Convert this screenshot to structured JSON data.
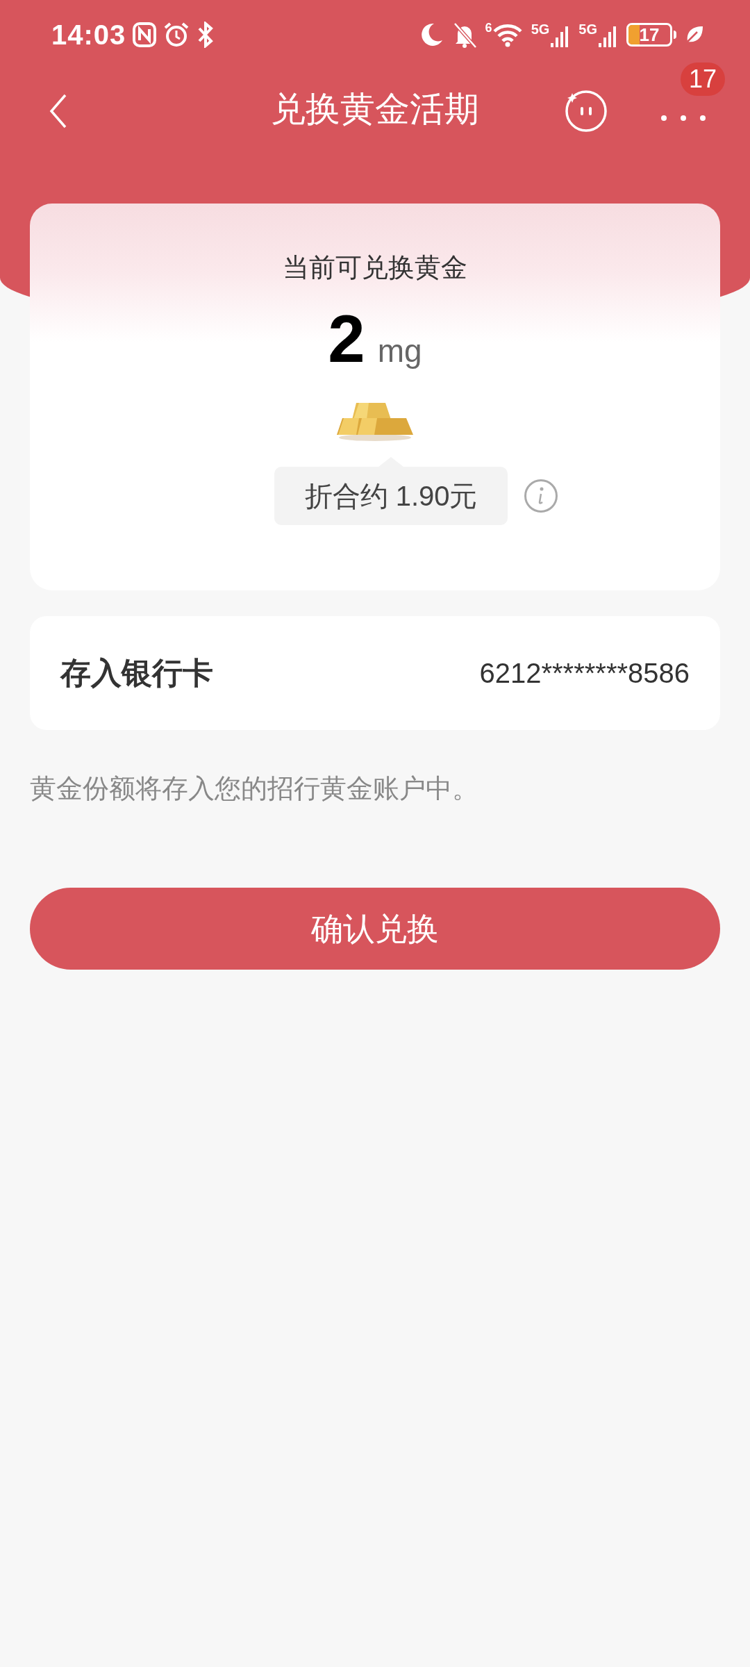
{
  "status_bar": {
    "time": "14:03",
    "wifi_label": "6",
    "signal_labels": [
      "5G",
      "5G"
    ],
    "battery": "17"
  },
  "header": {
    "title": "兑换黄金活期",
    "badge": "17"
  },
  "gold_card": {
    "label": "当前可兑换黄金",
    "amount": "2",
    "unit": "mg",
    "equivalent": "折合约 1.90元"
  },
  "bank_card": {
    "label": "存入银行卡",
    "number": "6212********8586"
  },
  "note": "黄金份额将存入您的招行黄金账户中。",
  "confirm_button": "确认兑换"
}
